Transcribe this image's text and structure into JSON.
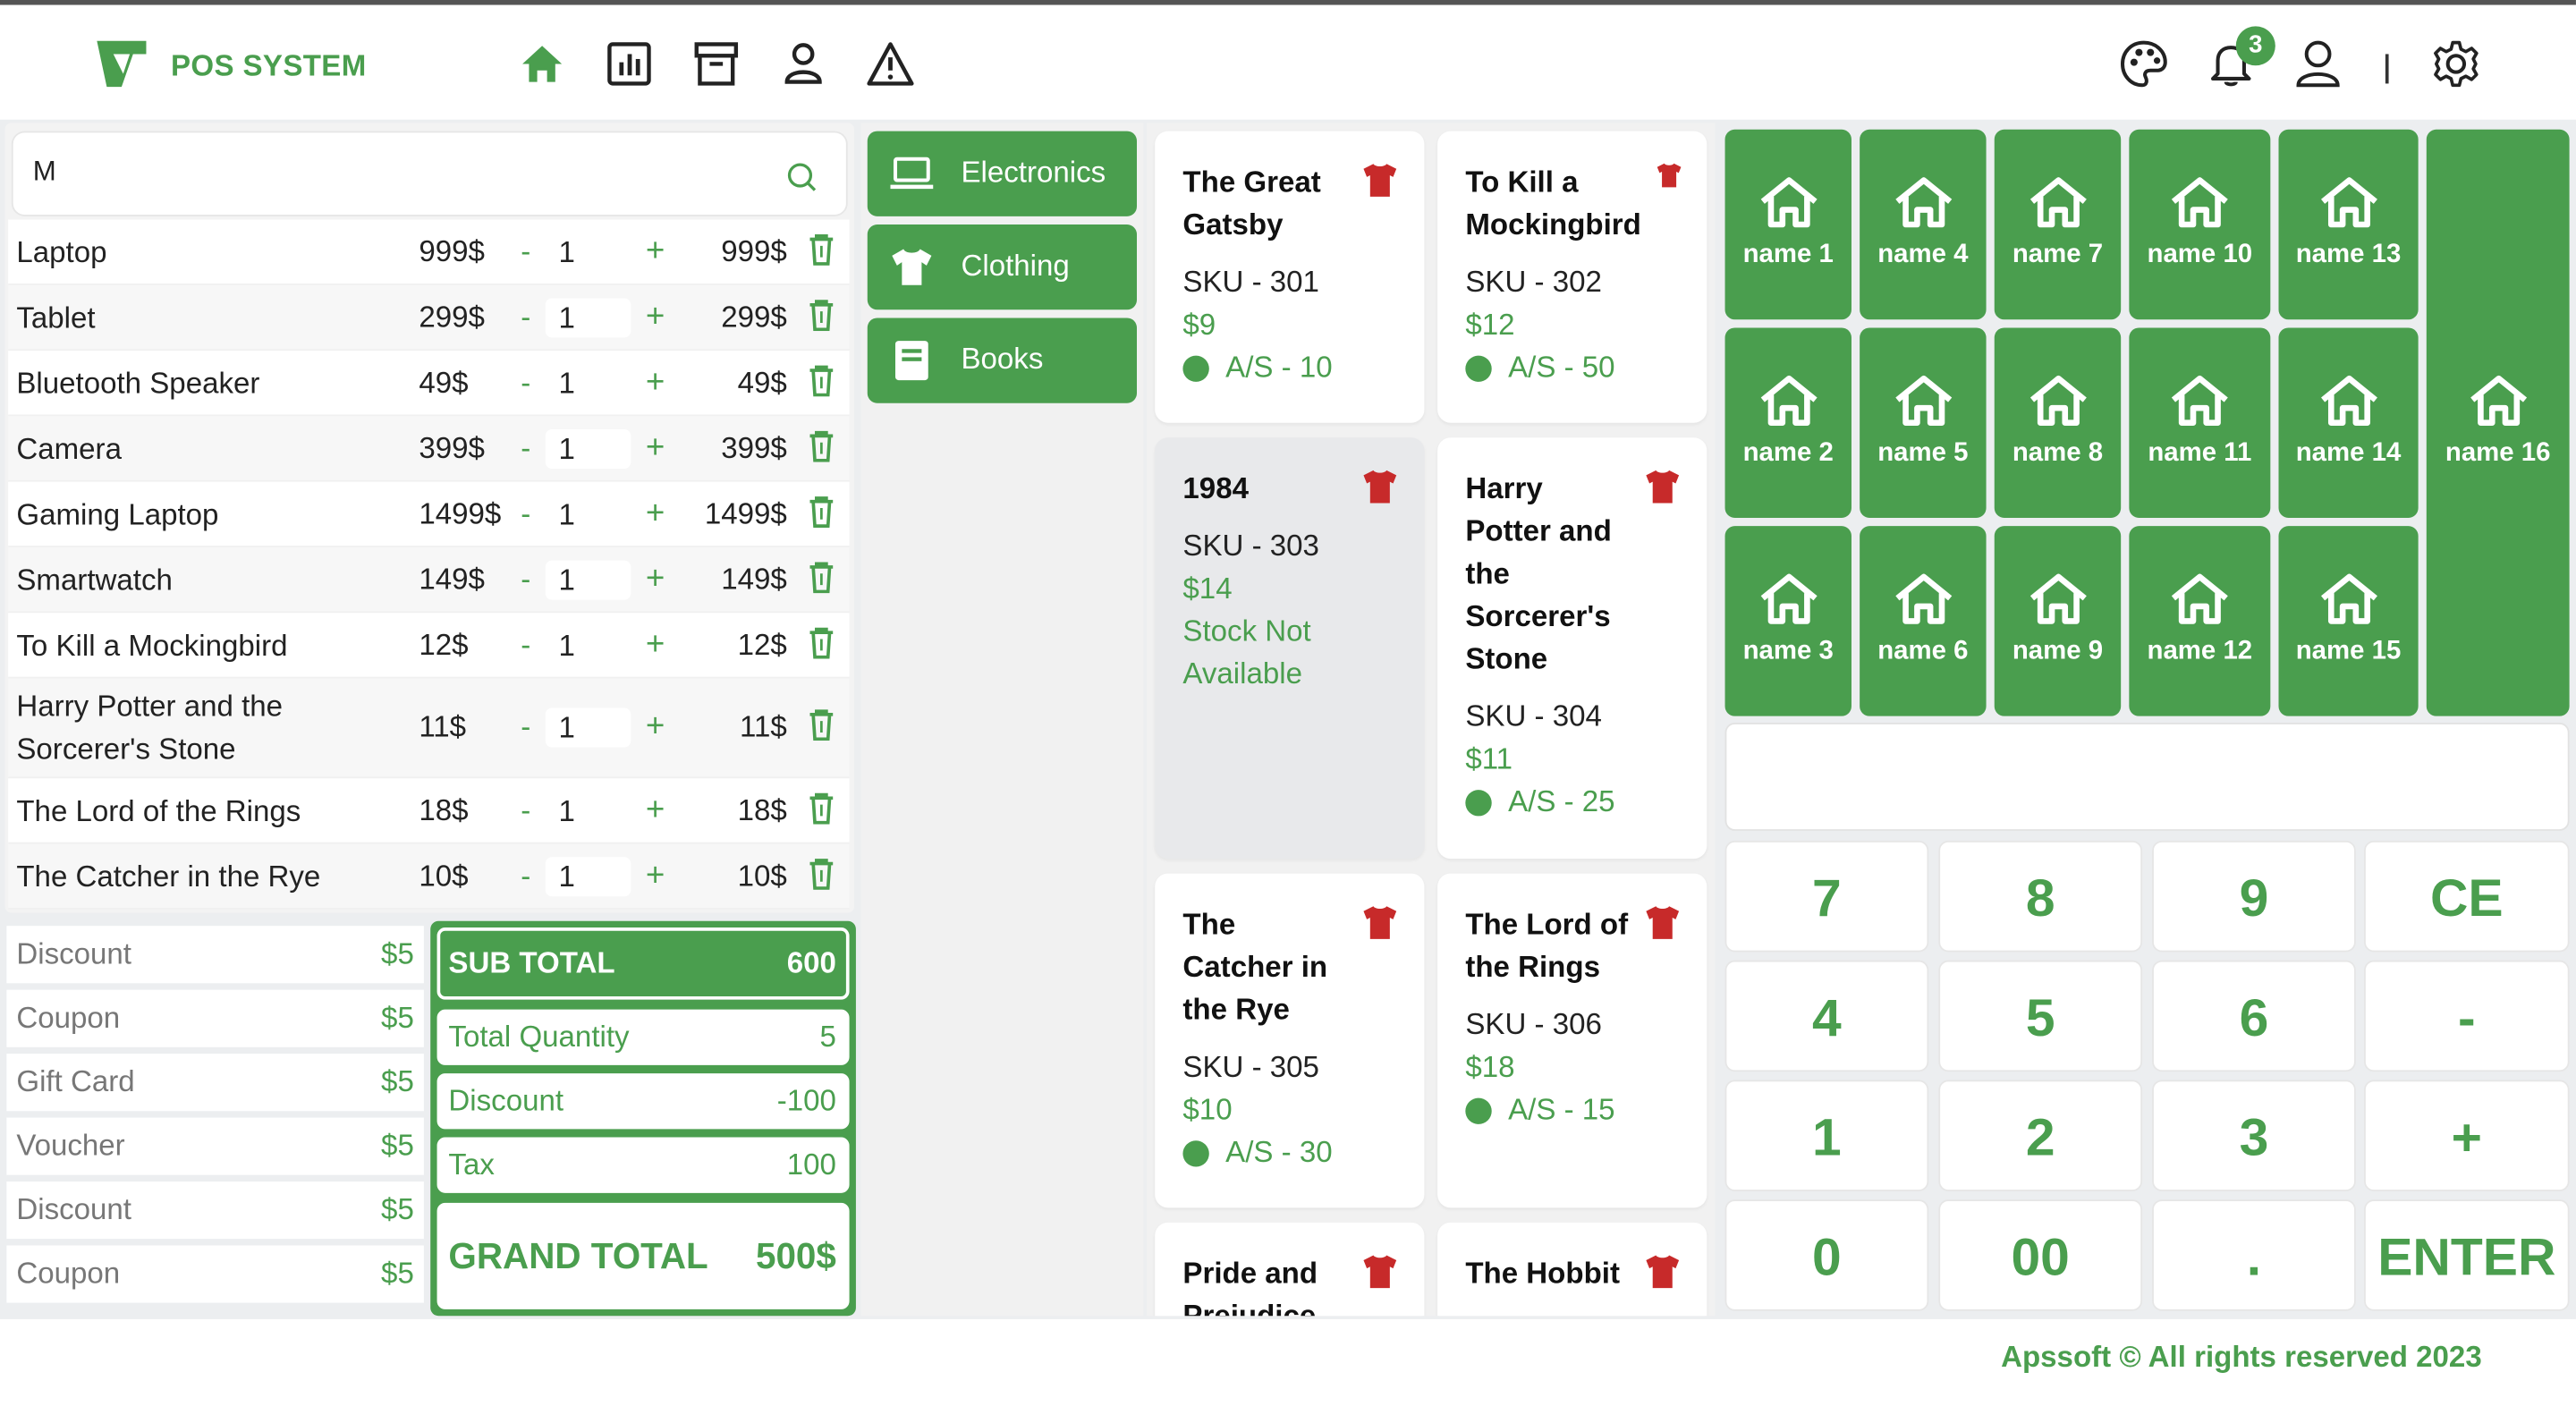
{
  "brand": {
    "name": "POS SYSTEM",
    "accent": "#4a9e4e"
  },
  "header": {
    "nav": [
      "home-icon",
      "chart-icon",
      "archive-icon",
      "user-icon",
      "warning-icon"
    ],
    "notifications_count": "3",
    "right_icons": [
      "palette-icon",
      "bell-icon",
      "profile-icon",
      "gear-icon"
    ],
    "separator": "|"
  },
  "search": {
    "value": "M"
  },
  "cart": {
    "items": [
      {
        "name": "Laptop",
        "price": "999$",
        "minus": "-",
        "qty": "1",
        "plus": "+",
        "total": "999$"
      },
      {
        "name": "Tablet",
        "price": "299$",
        "minus": "-",
        "qty": "1",
        "plus": "+",
        "total": "299$"
      },
      {
        "name": "Bluetooth Speaker",
        "price": "49$",
        "minus": "-",
        "qty": "1",
        "plus": "+",
        "total": "49$"
      },
      {
        "name": "Camera",
        "price": "399$",
        "minus": "-",
        "qty": "1",
        "plus": "+",
        "total": "399$"
      },
      {
        "name": "Gaming Laptop",
        "price": "1499$",
        "minus": "-",
        "qty": "1",
        "plus": "+",
        "total": "1499$"
      },
      {
        "name": "Smartwatch",
        "price": "149$",
        "minus": "-",
        "qty": "1",
        "plus": "+",
        "total": "149$"
      },
      {
        "name": "To Kill a Mockingbird",
        "price": "12$",
        "minus": "-",
        "qty": "1",
        "plus": "+",
        "total": "12$"
      },
      {
        "name": "Harry Potter and the Sorcerer's Stone",
        "price": "11$",
        "minus": "-",
        "qty": "1",
        "plus": "+",
        "total": "11$"
      },
      {
        "name": "The Lord of the Rings",
        "price": "18$",
        "minus": "-",
        "qty": "1",
        "plus": "+",
        "total": "18$"
      },
      {
        "name": "The Catcher in the Rye",
        "price": "10$",
        "minus": "-",
        "qty": "1",
        "plus": "+",
        "total": "10$"
      }
    ]
  },
  "adjustments": [
    {
      "label": "Discount",
      "value": "$5"
    },
    {
      "label": "Coupon",
      "value": "$5"
    },
    {
      "label": "Gift Card",
      "value": "$5"
    },
    {
      "label": "Voucher",
      "value": "$5"
    },
    {
      "label": "Discount",
      "value": "$5"
    },
    {
      "label": "Coupon",
      "value": "$5"
    }
  ],
  "totals": {
    "sub_total": {
      "label": "SUB TOTAL",
      "value": "600"
    },
    "total_quantity": {
      "label": "Total Quantity",
      "value": "5"
    },
    "discount": {
      "label": "Discount",
      "value": "-100"
    },
    "tax": {
      "label": "Tax",
      "value": "100"
    },
    "grand_total": {
      "label": "GRAND TOTAL",
      "value": "500$"
    }
  },
  "categories": [
    {
      "label": "Electronics",
      "icon": "laptop-icon"
    },
    {
      "label": "Clothing",
      "icon": "tshirt-icon"
    },
    {
      "label": "Books",
      "icon": "book-icon"
    }
  ],
  "products": [
    {
      "title": "The Great Gatsby",
      "sku": "SKU - 301",
      "price": "$9",
      "stock": "A/S - 10"
    },
    {
      "title": "To Kill a Mockingbird",
      "sku": "SKU - 302",
      "price": "$12",
      "stock": "A/S - 50"
    },
    {
      "title": "1984",
      "sku": "SKU - 303",
      "price": "$14",
      "stock": "Stock Not Available"
    },
    {
      "title": "Harry Potter and the Sorcerer's Stone",
      "sku": "SKU - 304",
      "price": "$11",
      "stock": "A/S - 25"
    },
    {
      "title": "The Catcher in the Rye",
      "sku": "SKU - 305",
      "price": "$10",
      "stock": "A/S - 30"
    },
    {
      "title": "The Lord of the Rings",
      "sku": "SKU - 306",
      "price": "$18",
      "stock": "A/S - 15"
    },
    {
      "title": "Pride and Prejudice"
    },
    {
      "title": "The Hobbit"
    }
  ],
  "tiles": [
    "name 1",
    "name 4",
    "name 7",
    "name 10",
    "name 13",
    "name 2",
    "name 5",
    "name 8",
    "name 11",
    "name 14",
    "name 3",
    "name 6",
    "name 9",
    "name 12",
    "name 15",
    "name 16"
  ],
  "keypad": [
    "7",
    "8",
    "9",
    "CE",
    "4",
    "5",
    "6",
    "-",
    "1",
    "2",
    "3",
    "+",
    "0",
    "00",
    ".",
    "ENTER"
  ],
  "footer": "Apssoft © All rights reserved 2023"
}
